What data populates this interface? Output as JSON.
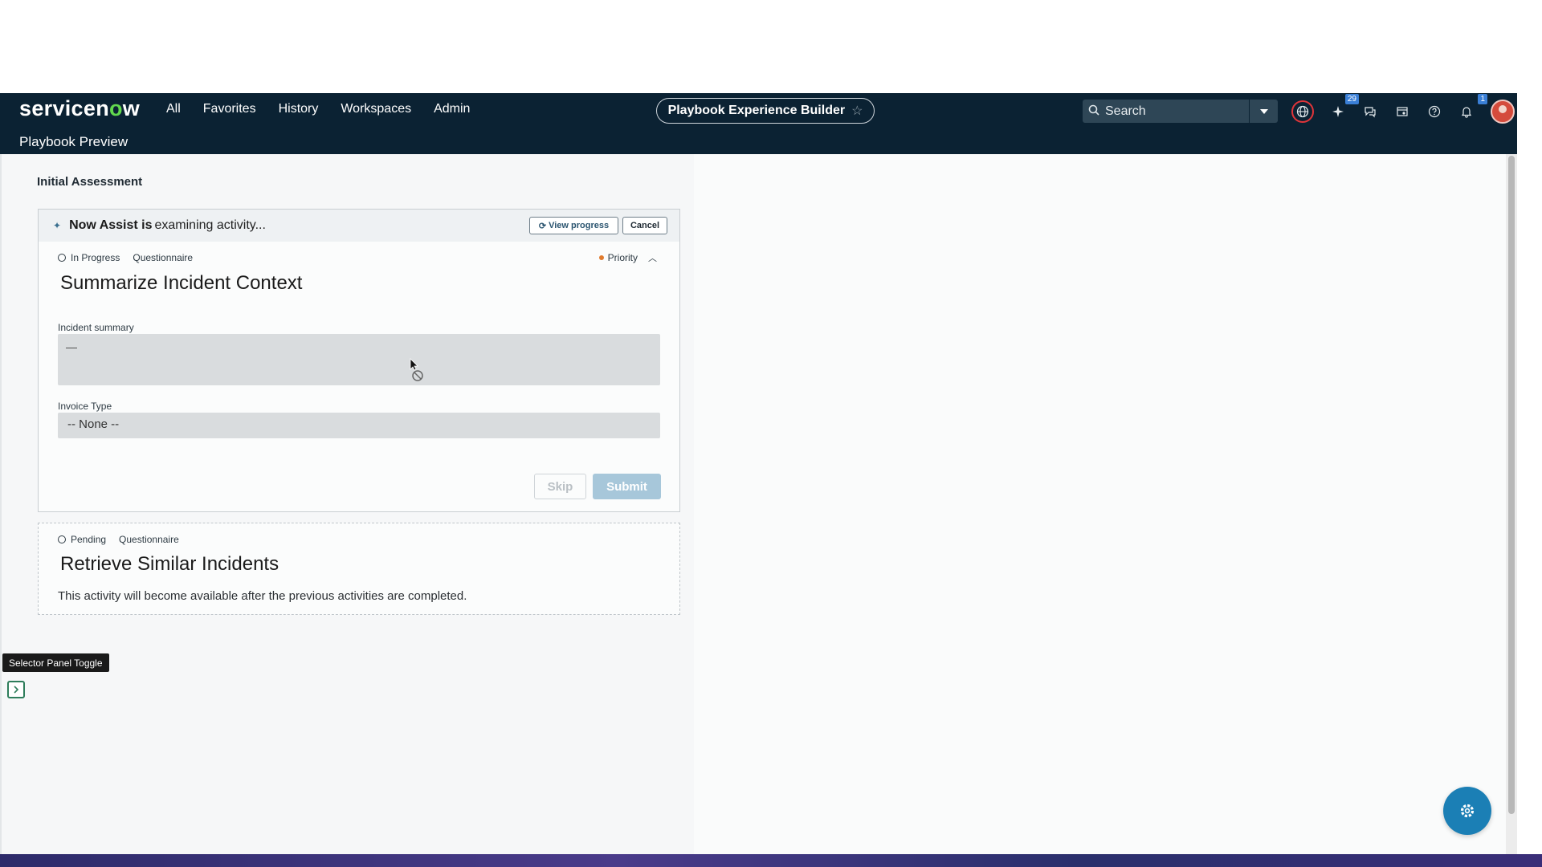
{
  "app": {
    "logo": {
      "prefix": "servicen",
      "accent": "o",
      "suffix": "w"
    },
    "subtitle": "Playbook Preview"
  },
  "nav": {
    "links": [
      "All",
      "Favorites",
      "History",
      "Workspaces",
      "Admin"
    ],
    "center_pill": "Playbook Experience Builder",
    "search_placeholder": "Search",
    "badges": {
      "sparkle": "29",
      "notifications": "1"
    }
  },
  "main": {
    "section_title": "Initial Assessment",
    "assist": {
      "title": "Now Assist is",
      "status": "examining activity...",
      "view_progress": "View progress",
      "cancel": "Cancel"
    },
    "activity1": {
      "status": "In Progress",
      "type": "Questionnaire",
      "priority": "Priority",
      "title": "Summarize Incident Context",
      "fields": {
        "incident_summary_label": "Incident summary",
        "incident_summary_value": "—",
        "invoice_type_label": "Invoice Type",
        "invoice_type_value": "-- None --"
      },
      "skip": "Skip",
      "submit": "Submit"
    },
    "activity2": {
      "status": "Pending",
      "type": "Questionnaire",
      "title": "Retrieve Similar Incidents",
      "description": "This activity will become available after the previous activities are completed."
    }
  },
  "tooltip": "Selector Panel Toggle",
  "colors": {
    "nav_bg": "#0b2233",
    "accent_green": "#62d84e",
    "submit_disabled": "#a7c7da",
    "fab": "#1b7fb5",
    "priority_dot": "#e07b2e"
  }
}
